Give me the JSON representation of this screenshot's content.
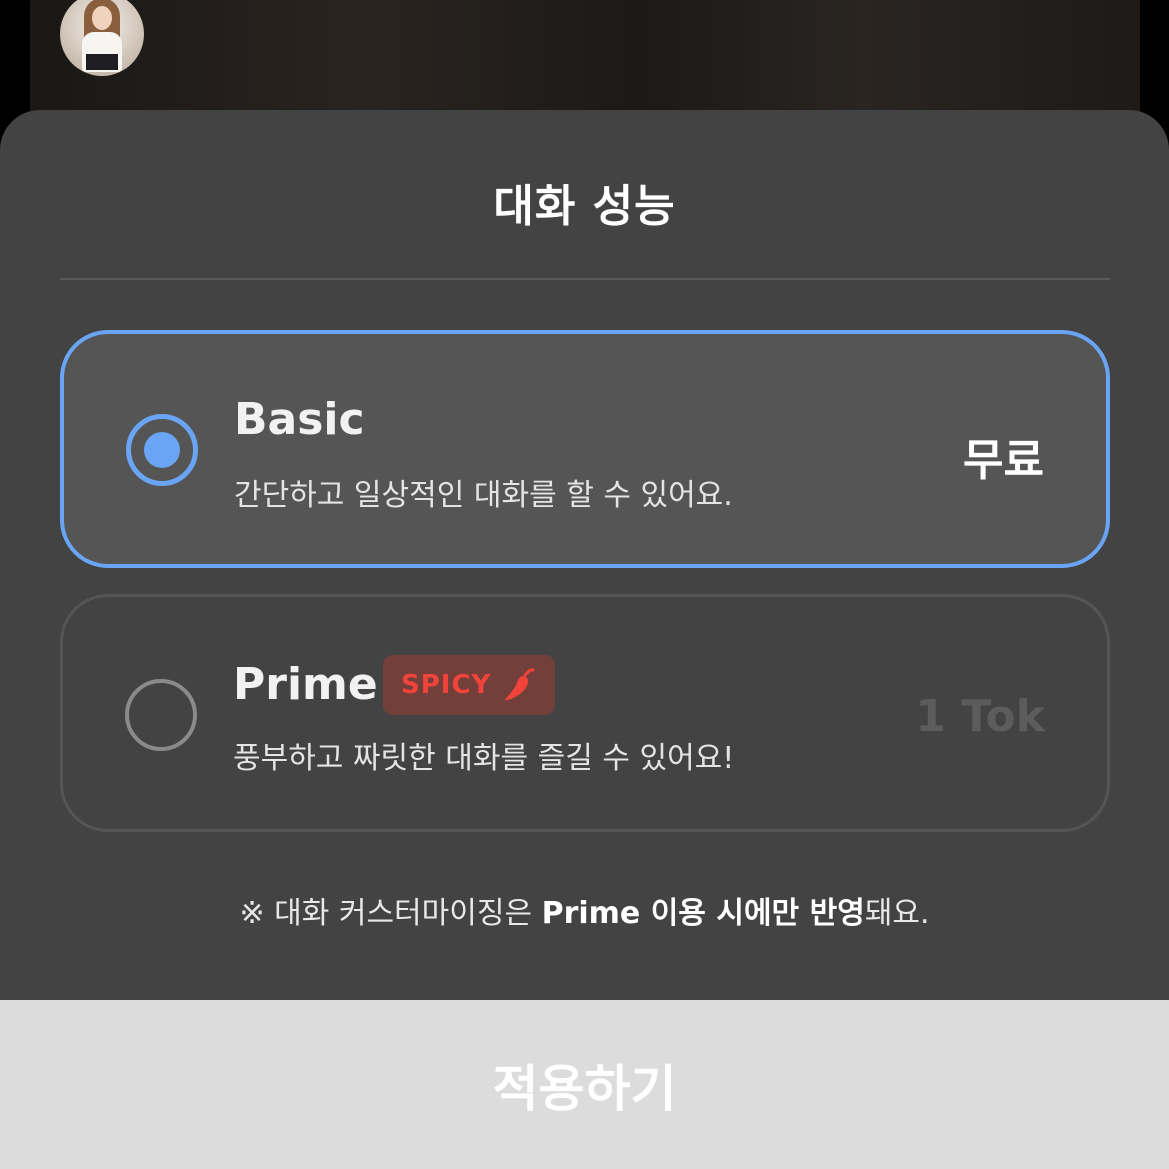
{
  "sheet": {
    "title": "대화 성능"
  },
  "options": [
    {
      "name": "Basic",
      "description": "간단하고 일상적인 대화를 할 수 있어요.",
      "price": "무료",
      "selected": true
    },
    {
      "name": "Prime",
      "badge": "SPICY",
      "badge_icon": "chili-pepper-icon",
      "description": "풍부하고 짜릿한 대화를 즐길 수 있어요!",
      "price": "1 Tok",
      "selected": false
    }
  ],
  "note": {
    "prefix": "※ 대화 커스터마이징은 ",
    "emphasis": "Prime 이용 시에만 반영",
    "suffix": "돼요."
  },
  "apply_button": {
    "label": "적용하기"
  },
  "colors": {
    "accent": "#6aa5f5",
    "sheet_bg": "#434343",
    "selected_card_bg": "#555555",
    "badge_bg": "#733f3b",
    "badge_text": "#f0443a",
    "button_bg": "#dcdcdc"
  }
}
